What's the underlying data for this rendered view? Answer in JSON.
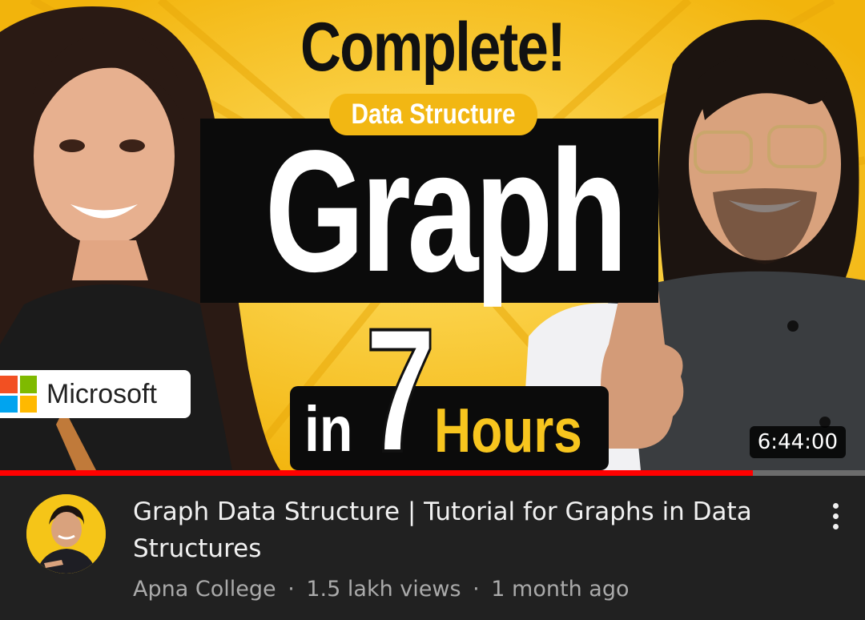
{
  "thumbnail": {
    "headline": "Complete!",
    "subheadline": "Data Structure",
    "main_word": "Graph",
    "number": "7",
    "in_word": "in",
    "hours_word": "Hours",
    "badge_label": "Microsoft",
    "duration": "6:44:00",
    "colors": {
      "background": "#f7c51e",
      "box": "#0b0b0b",
      "accent": "#f7c51e"
    }
  },
  "progress": {
    "watched_fraction": 0.87,
    "color": "#ff0000"
  },
  "video": {
    "title": "Graph Data Structure | Tutorial for Graphs in Data Structures",
    "channel": "Apna College",
    "views": "1.5 lakh views",
    "age": "1 month ago",
    "separator": "·"
  },
  "icons": {
    "more": "more-vert-icon",
    "avatar": "channel-avatar"
  }
}
